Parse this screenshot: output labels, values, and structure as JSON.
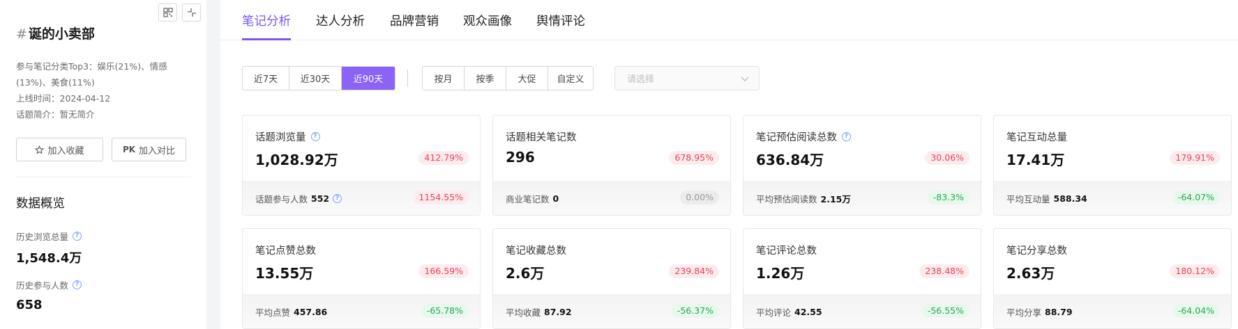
{
  "sidebar": {
    "title": "诞的小卖部",
    "info": {
      "category": "参与笔记分类Top3：娱乐(21%)、情感(13%)、美食(11%)",
      "online_time": "上线时间：2024-04-12",
      "intro": "话题简介：暂无简介"
    },
    "favorite_label": "加入收藏",
    "compare_label": "加入对比",
    "compare_prefix": "PK",
    "section_title": "数据概览",
    "metrics": [
      {
        "label": "历史浏览总量",
        "value": "1,548.4万"
      },
      {
        "label": "历史参与人数",
        "value": "658"
      }
    ]
  },
  "tabs": [
    "笔记分析",
    "达人分析",
    "品牌营销",
    "观众画像",
    "舆情评论"
  ],
  "active_tab": 0,
  "date_range": [
    "近7天",
    "近30天",
    "近90天"
  ],
  "date_range_active": 2,
  "period": [
    "按月",
    "按季",
    "大促",
    "自定义"
  ],
  "select_placeholder": "请选择",
  "cards": [
    {
      "title": "话题浏览量",
      "help": true,
      "value": "1,028.92万",
      "pct": "412.79%",
      "sub_label": "话题参与人数",
      "sub_value": "552",
      "sub_help": true,
      "sub_pct": "1154.55%",
      "sub_trend": "up"
    },
    {
      "title": "话题相关笔记数",
      "help": false,
      "value": "296",
      "pct": "678.95%",
      "sub_label": "商业笔记数",
      "sub_value": "0",
      "sub_help": false,
      "sub_pct": "0.00%",
      "sub_trend": "zero"
    },
    {
      "title": "笔记预估阅读总数",
      "help": true,
      "value": "636.84万",
      "pct": "30.06%",
      "sub_label": "平均预估阅读数",
      "sub_value": "2.15万",
      "sub_help": false,
      "sub_pct": "-83.3%",
      "sub_trend": "down"
    },
    {
      "title": "笔记互动总量",
      "help": false,
      "value": "17.41万",
      "pct": "179.91%",
      "sub_label": "平均互动量",
      "sub_value": "588.34",
      "sub_help": false,
      "sub_pct": "-64.07%",
      "sub_trend": "down"
    },
    {
      "title": "笔记点赞总数",
      "help": false,
      "value": "13.55万",
      "pct": "166.59%",
      "sub_label": "平均点赞",
      "sub_value": "457.86",
      "sub_help": false,
      "sub_pct": "-65.78%",
      "sub_trend": "down"
    },
    {
      "title": "笔记收藏总数",
      "help": false,
      "value": "2.6万",
      "pct": "239.84%",
      "sub_label": "平均收藏",
      "sub_value": "87.92",
      "sub_help": false,
      "sub_pct": "-56.37%",
      "sub_trend": "down"
    },
    {
      "title": "笔记评论总数",
      "help": false,
      "value": "1.26万",
      "pct": "238.48%",
      "sub_label": "平均评论",
      "sub_value": "42.55",
      "sub_help": false,
      "sub_pct": "-56.55%",
      "sub_trend": "down"
    },
    {
      "title": "笔记分享总数",
      "help": false,
      "value": "2.63万",
      "pct": "180.12%",
      "sub_label": "平均分享",
      "sub_value": "88.79",
      "sub_help": false,
      "sub_pct": "-64.04%",
      "sub_trend": "down"
    }
  ],
  "colors": {
    "accent": "#7a55f5",
    "up": "#ef3e55",
    "down": "#26a956"
  }
}
